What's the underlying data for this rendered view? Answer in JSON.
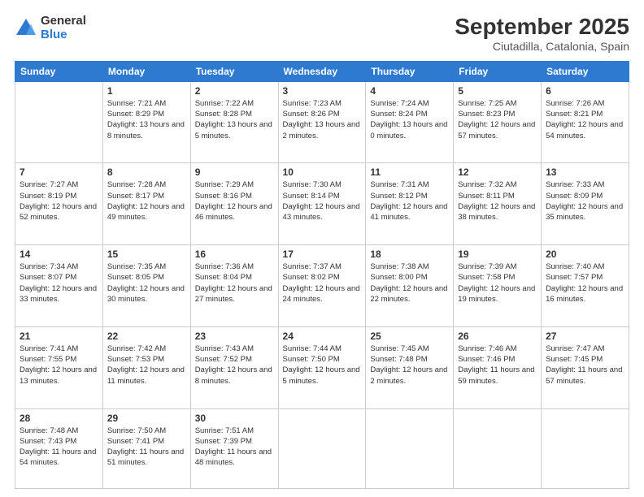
{
  "logo": {
    "general": "General",
    "blue": "Blue"
  },
  "title": "September 2025",
  "subtitle": "Ciutadilla, Catalonia, Spain",
  "headers": [
    "Sunday",
    "Monday",
    "Tuesday",
    "Wednesday",
    "Thursday",
    "Friday",
    "Saturday"
  ],
  "weeks": [
    [
      {
        "day": "",
        "sunrise": "",
        "sunset": "",
        "daylight": ""
      },
      {
        "day": "1",
        "sunrise": "Sunrise: 7:21 AM",
        "sunset": "Sunset: 8:29 PM",
        "daylight": "Daylight: 13 hours and 8 minutes."
      },
      {
        "day": "2",
        "sunrise": "Sunrise: 7:22 AM",
        "sunset": "Sunset: 8:28 PM",
        "daylight": "Daylight: 13 hours and 5 minutes."
      },
      {
        "day": "3",
        "sunrise": "Sunrise: 7:23 AM",
        "sunset": "Sunset: 8:26 PM",
        "daylight": "Daylight: 13 hours and 2 minutes."
      },
      {
        "day": "4",
        "sunrise": "Sunrise: 7:24 AM",
        "sunset": "Sunset: 8:24 PM",
        "daylight": "Daylight: 13 hours and 0 minutes."
      },
      {
        "day": "5",
        "sunrise": "Sunrise: 7:25 AM",
        "sunset": "Sunset: 8:23 PM",
        "daylight": "Daylight: 12 hours and 57 minutes."
      },
      {
        "day": "6",
        "sunrise": "Sunrise: 7:26 AM",
        "sunset": "Sunset: 8:21 PM",
        "daylight": "Daylight: 12 hours and 54 minutes."
      }
    ],
    [
      {
        "day": "7",
        "sunrise": "Sunrise: 7:27 AM",
        "sunset": "Sunset: 8:19 PM",
        "daylight": "Daylight: 12 hours and 52 minutes."
      },
      {
        "day": "8",
        "sunrise": "Sunrise: 7:28 AM",
        "sunset": "Sunset: 8:17 PM",
        "daylight": "Daylight: 12 hours and 49 minutes."
      },
      {
        "day": "9",
        "sunrise": "Sunrise: 7:29 AM",
        "sunset": "Sunset: 8:16 PM",
        "daylight": "Daylight: 12 hours and 46 minutes."
      },
      {
        "day": "10",
        "sunrise": "Sunrise: 7:30 AM",
        "sunset": "Sunset: 8:14 PM",
        "daylight": "Daylight: 12 hours and 43 minutes."
      },
      {
        "day": "11",
        "sunrise": "Sunrise: 7:31 AM",
        "sunset": "Sunset: 8:12 PM",
        "daylight": "Daylight: 12 hours and 41 minutes."
      },
      {
        "day": "12",
        "sunrise": "Sunrise: 7:32 AM",
        "sunset": "Sunset: 8:11 PM",
        "daylight": "Daylight: 12 hours and 38 minutes."
      },
      {
        "day": "13",
        "sunrise": "Sunrise: 7:33 AM",
        "sunset": "Sunset: 8:09 PM",
        "daylight": "Daylight: 12 hours and 35 minutes."
      }
    ],
    [
      {
        "day": "14",
        "sunrise": "Sunrise: 7:34 AM",
        "sunset": "Sunset: 8:07 PM",
        "daylight": "Daylight: 12 hours and 33 minutes."
      },
      {
        "day": "15",
        "sunrise": "Sunrise: 7:35 AM",
        "sunset": "Sunset: 8:05 PM",
        "daylight": "Daylight: 12 hours and 30 minutes."
      },
      {
        "day": "16",
        "sunrise": "Sunrise: 7:36 AM",
        "sunset": "Sunset: 8:04 PM",
        "daylight": "Daylight: 12 hours and 27 minutes."
      },
      {
        "day": "17",
        "sunrise": "Sunrise: 7:37 AM",
        "sunset": "Sunset: 8:02 PM",
        "daylight": "Daylight: 12 hours and 24 minutes."
      },
      {
        "day": "18",
        "sunrise": "Sunrise: 7:38 AM",
        "sunset": "Sunset: 8:00 PM",
        "daylight": "Daylight: 12 hours and 22 minutes."
      },
      {
        "day": "19",
        "sunrise": "Sunrise: 7:39 AM",
        "sunset": "Sunset: 7:58 PM",
        "daylight": "Daylight: 12 hours and 19 minutes."
      },
      {
        "day": "20",
        "sunrise": "Sunrise: 7:40 AM",
        "sunset": "Sunset: 7:57 PM",
        "daylight": "Daylight: 12 hours and 16 minutes."
      }
    ],
    [
      {
        "day": "21",
        "sunrise": "Sunrise: 7:41 AM",
        "sunset": "Sunset: 7:55 PM",
        "daylight": "Daylight: 12 hours and 13 minutes."
      },
      {
        "day": "22",
        "sunrise": "Sunrise: 7:42 AM",
        "sunset": "Sunset: 7:53 PM",
        "daylight": "Daylight: 12 hours and 11 minutes."
      },
      {
        "day": "23",
        "sunrise": "Sunrise: 7:43 AM",
        "sunset": "Sunset: 7:52 PM",
        "daylight": "Daylight: 12 hours and 8 minutes."
      },
      {
        "day": "24",
        "sunrise": "Sunrise: 7:44 AM",
        "sunset": "Sunset: 7:50 PM",
        "daylight": "Daylight: 12 hours and 5 minutes."
      },
      {
        "day": "25",
        "sunrise": "Sunrise: 7:45 AM",
        "sunset": "Sunset: 7:48 PM",
        "daylight": "Daylight: 12 hours and 2 minutes."
      },
      {
        "day": "26",
        "sunrise": "Sunrise: 7:46 AM",
        "sunset": "Sunset: 7:46 PM",
        "daylight": "Daylight: 11 hours and 59 minutes."
      },
      {
        "day": "27",
        "sunrise": "Sunrise: 7:47 AM",
        "sunset": "Sunset: 7:45 PM",
        "daylight": "Daylight: 11 hours and 57 minutes."
      }
    ],
    [
      {
        "day": "28",
        "sunrise": "Sunrise: 7:48 AM",
        "sunset": "Sunset: 7:43 PM",
        "daylight": "Daylight: 11 hours and 54 minutes."
      },
      {
        "day": "29",
        "sunrise": "Sunrise: 7:50 AM",
        "sunset": "Sunset: 7:41 PM",
        "daylight": "Daylight: 11 hours and 51 minutes."
      },
      {
        "day": "30",
        "sunrise": "Sunrise: 7:51 AM",
        "sunset": "Sunset: 7:39 PM",
        "daylight": "Daylight: 11 hours and 48 minutes."
      },
      {
        "day": "",
        "sunrise": "",
        "sunset": "",
        "daylight": ""
      },
      {
        "day": "",
        "sunrise": "",
        "sunset": "",
        "daylight": ""
      },
      {
        "day": "",
        "sunrise": "",
        "sunset": "",
        "daylight": ""
      },
      {
        "day": "",
        "sunrise": "",
        "sunset": "",
        "daylight": ""
      }
    ]
  ]
}
